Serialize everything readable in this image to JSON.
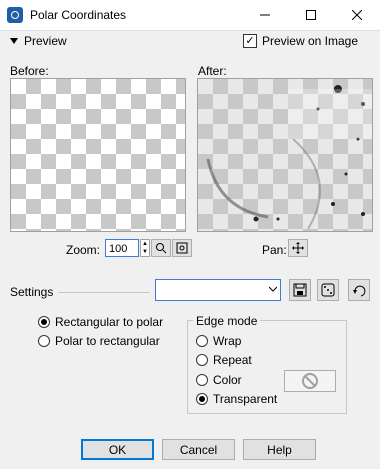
{
  "window": {
    "title": "Polar Coordinates",
    "icon": "polar-coordinates-app-icon"
  },
  "preview_section": {
    "label": "Preview",
    "preview_on_image_label": "Preview on Image",
    "preview_on_image_checked": true
  },
  "panels": {
    "before_label": "Before:",
    "after_label": "After:"
  },
  "zoom": {
    "label": "Zoom:",
    "value": "100"
  },
  "pan": {
    "label": "Pan:"
  },
  "settings": {
    "label": "Settings",
    "selected": ""
  },
  "mode": {
    "options": [
      {
        "label": "Rectangular to polar",
        "selected": true
      },
      {
        "label": "Polar to rectangular",
        "selected": false
      }
    ]
  },
  "edge_mode": {
    "title": "Edge mode",
    "options": [
      {
        "label": "Wrap",
        "selected": false
      },
      {
        "label": "Repeat",
        "selected": false
      },
      {
        "label": "Color",
        "selected": false
      },
      {
        "label": "Transparent",
        "selected": true
      }
    ]
  },
  "buttons": {
    "ok": "OK",
    "cancel": "Cancel",
    "help": "Help"
  },
  "colors": {
    "accent": "#0078d7",
    "dialog_bg": "#f0f0f0",
    "checker": "#c8c8c8"
  }
}
